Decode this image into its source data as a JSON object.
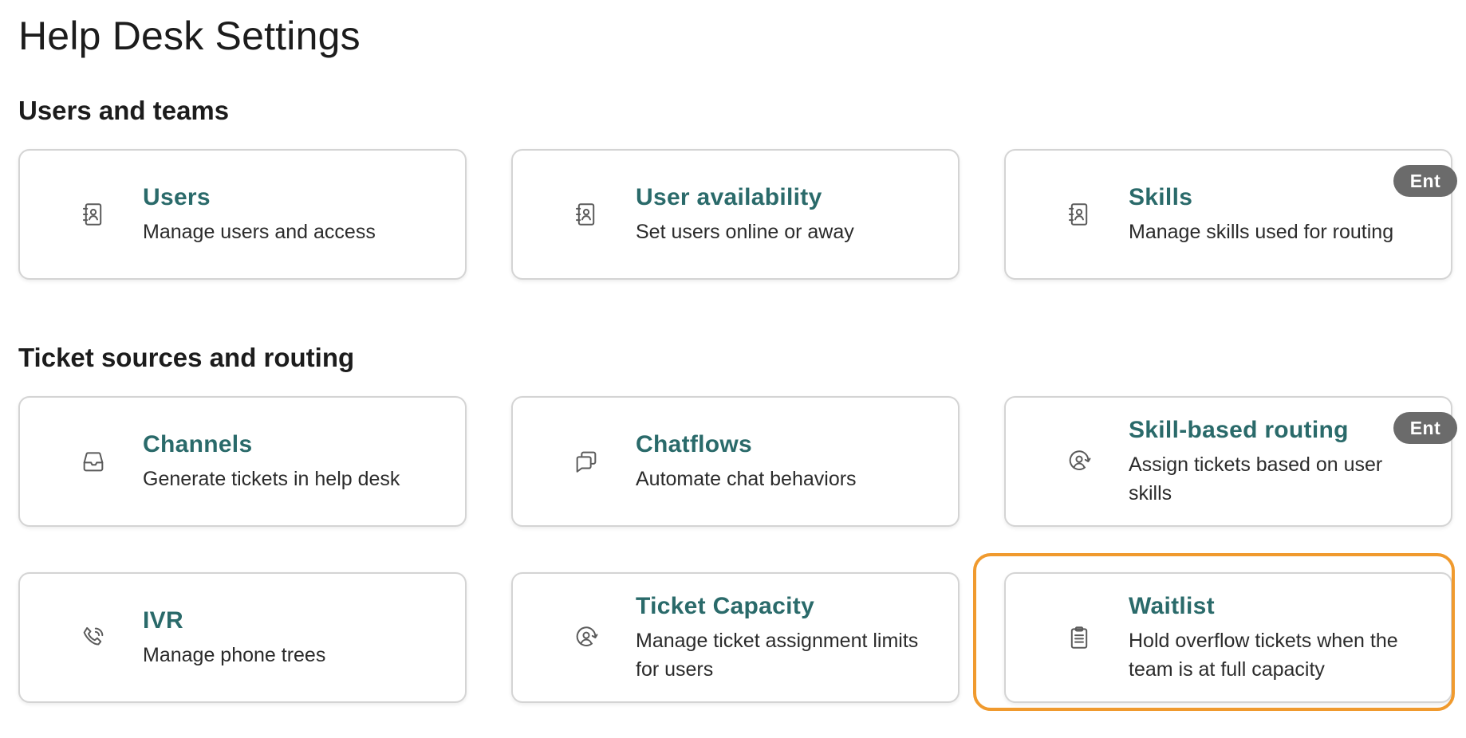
{
  "page": {
    "title": "Help Desk Settings"
  },
  "sections": [
    {
      "title": "Users and teams",
      "cards": [
        {
          "title": "Users",
          "description": "Manage users and access",
          "icon": "contact-book-icon",
          "badge": ""
        },
        {
          "title": "User availability",
          "description": "Set users online or away",
          "icon": "contact-book-icon",
          "badge": ""
        },
        {
          "title": "Skills",
          "description": "Manage skills used for routing",
          "icon": "contact-book-icon",
          "badge": "Ent"
        }
      ]
    },
    {
      "title": "Ticket sources and routing",
      "cards": [
        {
          "title": "Channels",
          "description": "Generate tickets in help desk",
          "icon": "inbox-icon",
          "badge": ""
        },
        {
          "title": "Chatflows",
          "description": "Automate chat behaviors",
          "icon": "chat-bubbles-icon",
          "badge": ""
        },
        {
          "title": "Skill-based routing",
          "description": "Assign tickets based on user skills",
          "icon": "user-routing-icon",
          "badge": "Ent"
        },
        {
          "title": "IVR",
          "description": "Manage phone trees",
          "icon": "phone-icon",
          "badge": ""
        },
        {
          "title": "Ticket Capacity",
          "description": "Manage ticket assignment limits for users",
          "icon": "user-routing-icon",
          "badge": ""
        },
        {
          "title": "Waitlist",
          "description": "Hold overflow tickets when the team is at full capacity",
          "icon": "clipboard-list-icon",
          "badge": ""
        }
      ]
    }
  ],
  "colors": {
    "title_accent": "#2a6a6a",
    "highlight": "#f09a2e",
    "badge_bg": "#6b6b6b"
  }
}
